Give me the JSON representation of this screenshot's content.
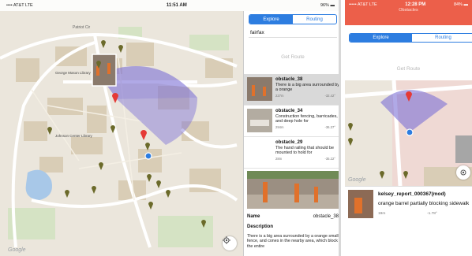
{
  "ipad": {
    "status": {
      "carrier": "•••• AT&T  LTE",
      "time": "11:51 AM",
      "battery": "96%"
    },
    "tabs": [
      {
        "label": "Explore",
        "active": true
      },
      {
        "label": "Routing",
        "active": false
      }
    ],
    "search_value": "fairfax",
    "get_route_label": "Get Route",
    "results": [
      {
        "title": "obstacle_38",
        "text": "There is a big area surrounded by a orange",
        "distance": "227m",
        "angle": "-32.42°",
        "selected": true
      },
      {
        "title": "obstacle_34",
        "text": "Construction fencing, barricades, and deep hole for",
        "distance": "294m",
        "angle": "-36.37°",
        "selected": false
      },
      {
        "title": "obstacle_29",
        "text": "The hand railing that should be mounted to hold for",
        "distance": "28m",
        "angle": "-35.22°",
        "selected": false
      }
    ],
    "detail": {
      "name_label": "Name",
      "name_value": "obstacle_38",
      "description_label": "Description",
      "description_text": "There is a big area surrounded by a orange small fence, and cones in the nearby area, which block the entire"
    },
    "map_labels": {
      "library": "George Mason Library",
      "johnson": "Johnson Center Library",
      "patriot": "Patriot Cir",
      "google": "Google"
    }
  },
  "phone": {
    "status": {
      "carrier": "••••• AT&T  LTE",
      "time": "12:28 PM",
      "battery": "84%",
      "subtitle": "Obstacles"
    },
    "tabs": [
      {
        "label": "Explore",
        "active": true
      },
      {
        "label": "Routing",
        "active": false
      }
    ],
    "get_route_label": "Get Route",
    "google": "Google",
    "report": {
      "title": "kelsey_report_000367(mod)",
      "text": "orange barrel partially blocking sidewalk",
      "distance": "19m",
      "angle": "-1.78°"
    }
  },
  "colors": {
    "accent": "#2d7de0",
    "phone_header": "#ec5f4a",
    "cone": "#7b6fd6",
    "pin_red": "#e53935",
    "pin_olive": "#6b6a2a"
  }
}
